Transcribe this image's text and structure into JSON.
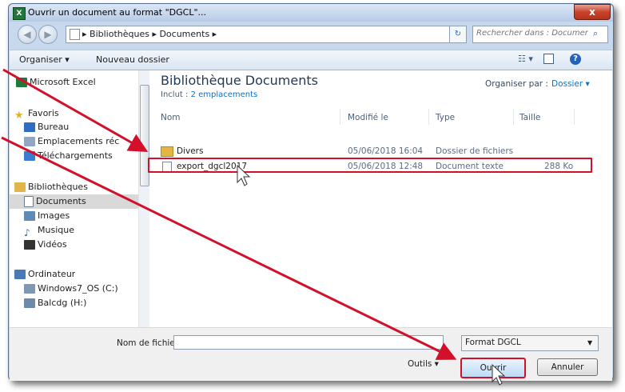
{
  "window": {
    "title": "Ouvrir un document au format \"DGCL\"...",
    "close_label": "x"
  },
  "address": {
    "crumbs": "▸ Bibliothèques ▸ Documents ▸",
    "search_placeholder": "Rechercher dans : Documents"
  },
  "toolbar": {
    "organize": "Organiser ▾",
    "new_folder": "Nouveau dossier",
    "help": "?"
  },
  "nav": [
    {
      "label": "Microsoft Excel",
      "icon": "excel-icon"
    },
    {
      "label": "Favoris",
      "icon": "star-icon"
    },
    {
      "label": "Bureau",
      "icon": "desktop-icon"
    },
    {
      "label": "Emplacements réc",
      "icon": "recent-places-icon"
    },
    {
      "label": "Téléchargements",
      "icon": "downloads-icon"
    },
    {
      "label": "Bibliothèques",
      "icon": "libraries-icon"
    },
    {
      "label": "Documents",
      "icon": "documents-icon"
    },
    {
      "label": "Images",
      "icon": "images-icon"
    },
    {
      "label": "Musique",
      "icon": "music-icon"
    },
    {
      "label": "Vidéos",
      "icon": "videos-icon"
    },
    {
      "label": "Ordinateur",
      "icon": "computer-icon"
    },
    {
      "label": "Windows7_OS (C:)",
      "icon": "drive-icon"
    },
    {
      "label": "Balcdg (H:)",
      "icon": "network-drive-icon"
    }
  ],
  "library": {
    "title": "Bibliothèque Documents",
    "includes_label": "Inclut :",
    "includes_link": "2 emplacements",
    "arrange_label": "Organiser par :",
    "arrange_value": "Dossier ▾"
  },
  "columns": {
    "name": "Nom",
    "modified": "Modifié le",
    "type": "Type",
    "size": "Taille"
  },
  "files": [
    {
      "name": "Divers",
      "modified": "05/06/2018 16:04",
      "type": "Dossier de fichiers",
      "size": ""
    },
    {
      "name": "export_dgcl2017",
      "modified": "05/06/2018 12:48",
      "type": "Document texte",
      "size": "288 Ko"
    }
  ],
  "bottom": {
    "filename_label": "Nom de fichier :",
    "filename_value": "",
    "format": "Format DGCL",
    "tools": "Outils ▾",
    "open": "Ouvrir",
    "cancel": "Annuler"
  }
}
